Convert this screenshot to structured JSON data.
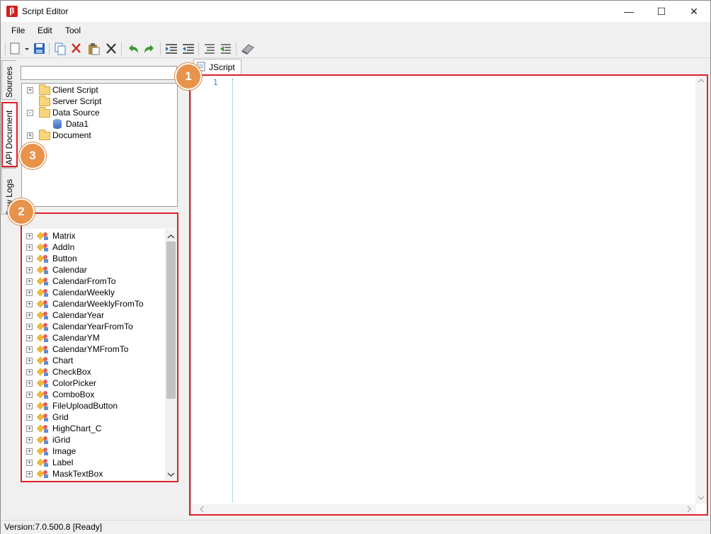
{
  "window": {
    "title": "Script Editor",
    "minimize": "—",
    "maximize": "☐",
    "close": "✕"
  },
  "menu": {
    "items": [
      "File",
      "Edit",
      "Tool"
    ]
  },
  "toolbar": {
    "icons": [
      "new-document-icon",
      "save-icon",
      "copy-icon",
      "cut-icon",
      "paste-icon",
      "delete-icon",
      "undo-icon",
      "redo-icon",
      "indent-icon",
      "outdent-icon",
      "comment-icon",
      "uncomment-icon",
      "eraser-icon"
    ]
  },
  "side_tabs": {
    "sources": "Sources",
    "api_document": "API Document",
    "view_logs": "View Logs"
  },
  "sources_tree": {
    "items": [
      {
        "label": "Client Script",
        "expander": "+"
      },
      {
        "label": "Server Script",
        "expander": ""
      },
      {
        "label": "Data Source",
        "expander": "-"
      },
      {
        "label": "Data1",
        "expander": ""
      },
      {
        "label": "Document",
        "expander": "+"
      }
    ]
  },
  "api_tree": {
    "items": [
      "Matrix",
      "AddIn",
      "Button",
      "Calendar",
      "CalendarFromTo",
      "CalendarWeekly",
      "CalendarWeeklyFromTo",
      "CalendarYear",
      "CalendarYearFromTo",
      "CalendarYM",
      "CalendarYMFromTo",
      "Chart",
      "CheckBox",
      "ColorPicker",
      "ComboBox",
      "FileUploadButton",
      "Grid",
      "HighChart_C",
      "iGrid",
      "Image",
      "Label",
      "MaskTextBox"
    ]
  },
  "editor": {
    "tab_label": "JScript",
    "line_number": "1"
  },
  "annotations": {
    "badge1": "1",
    "badge2": "2",
    "badge3": "3"
  },
  "status": {
    "text": "Version:7.0.500.8  [Ready]"
  }
}
